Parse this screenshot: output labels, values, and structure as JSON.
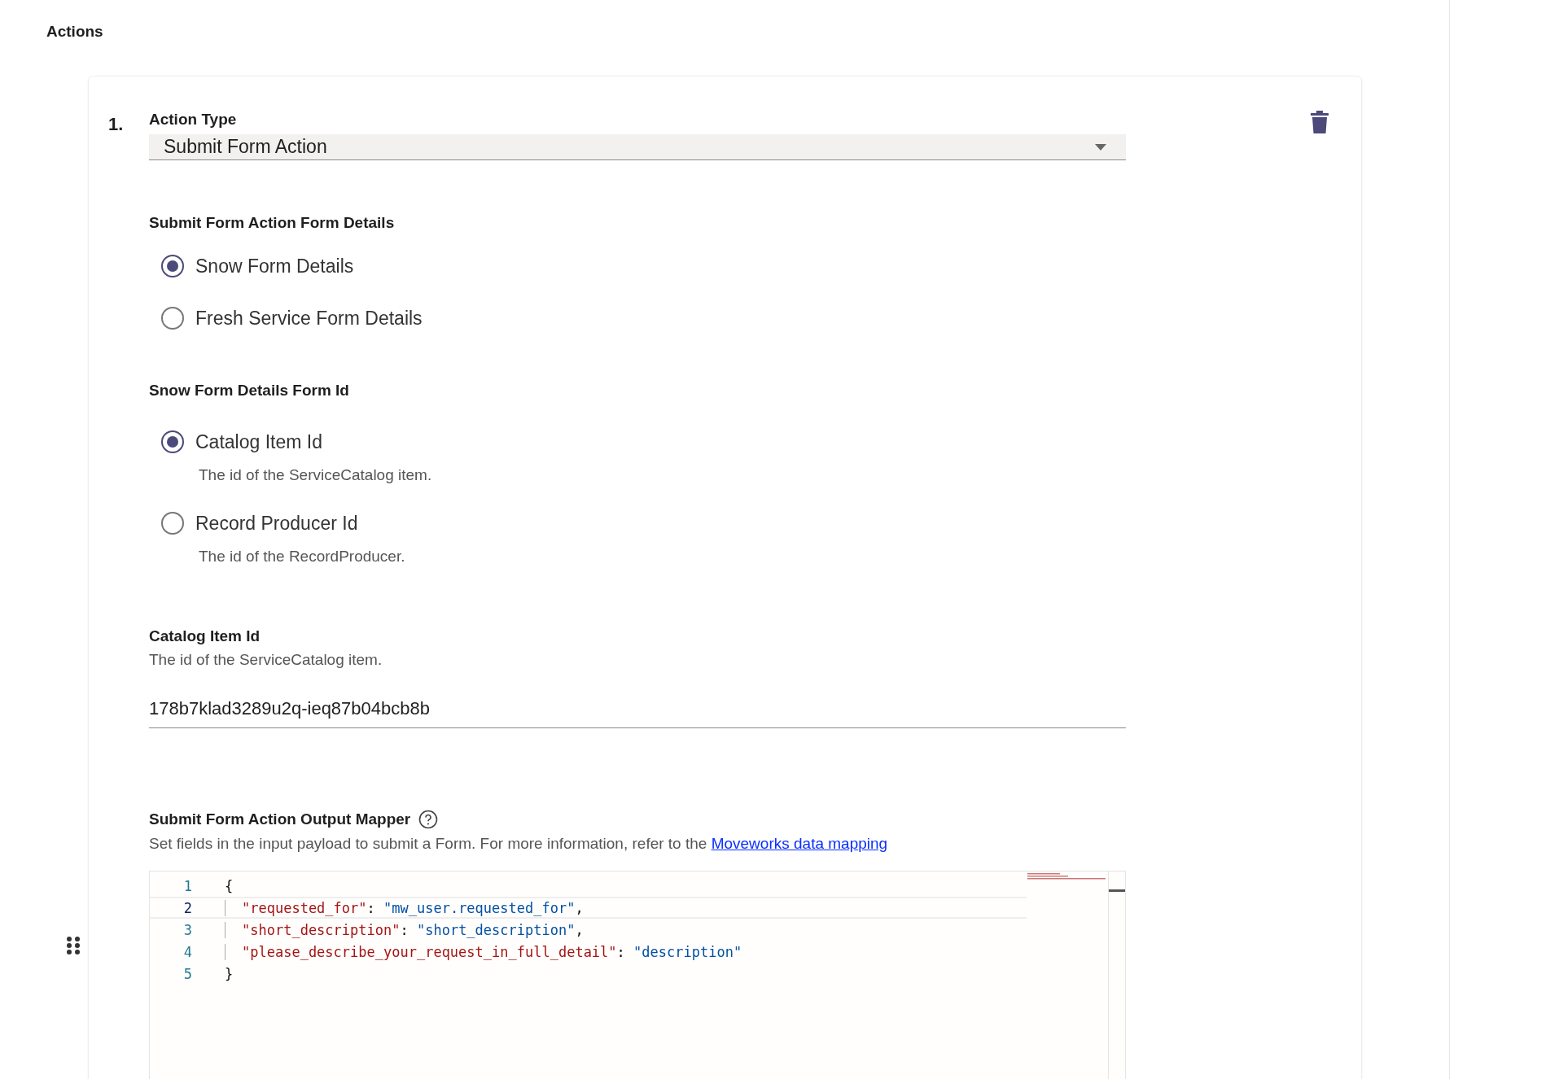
{
  "page_title": "Actions",
  "action": {
    "index": "1.",
    "type_label": "Action Type",
    "type_value": "Submit Form Action",
    "form_details": {
      "title": "Submit Form Action Form Details",
      "options": [
        {
          "label": "Snow Form Details",
          "selected": true
        },
        {
          "label": "Fresh Service Form Details",
          "selected": false
        }
      ]
    },
    "form_id": {
      "title": "Snow Form Details Form Id",
      "options": [
        {
          "label": "Catalog Item Id",
          "description": "The id of the ServiceCatalog item.",
          "selected": true
        },
        {
          "label": "Record Producer Id",
          "description": "The id of the RecordProducer.",
          "selected": false
        }
      ]
    },
    "catalog_field": {
      "label": "Catalog Item Id",
      "description": "The id of the ServiceCatalog item.",
      "value": "178b7klad3289u2q-ieq87b04bcb8b"
    },
    "mapper": {
      "title": "Submit Form Action Output Mapper",
      "description": "Set fields in the input payload to submit a Form. For more information, refer to the ",
      "link": "Moveworks data mapping",
      "lines": [
        {
          "number": "1",
          "active": false,
          "tokens": [
            {
              "kind": "punct",
              "text": "{"
            }
          ]
        },
        {
          "number": "2",
          "active": true,
          "tokens": [
            {
              "kind": "key",
              "text": "\"requested_for\""
            },
            {
              "kind": "punct",
              "text": ": "
            },
            {
              "kind": "string",
              "text": "\"mw_user.requested_for\""
            },
            {
              "kind": "punct",
              "text": ","
            }
          ]
        },
        {
          "number": "3",
          "active": false,
          "tokens": [
            {
              "kind": "key",
              "text": "\"short_description\""
            },
            {
              "kind": "punct",
              "text": ": "
            },
            {
              "kind": "string",
              "text": "\"short_description\""
            },
            {
              "kind": "punct",
              "text": ","
            }
          ]
        },
        {
          "number": "4",
          "active": false,
          "tokens": [
            {
              "kind": "key",
              "text": "\"please_describe_your_request_in_full_detail\""
            },
            {
              "kind": "punct",
              "text": ": "
            },
            {
              "kind": "string",
              "text": "\"description\""
            }
          ]
        },
        {
          "number": "5",
          "active": false,
          "tokens": [
            {
              "kind": "punct",
              "text": "}"
            }
          ]
        }
      ]
    }
  }
}
